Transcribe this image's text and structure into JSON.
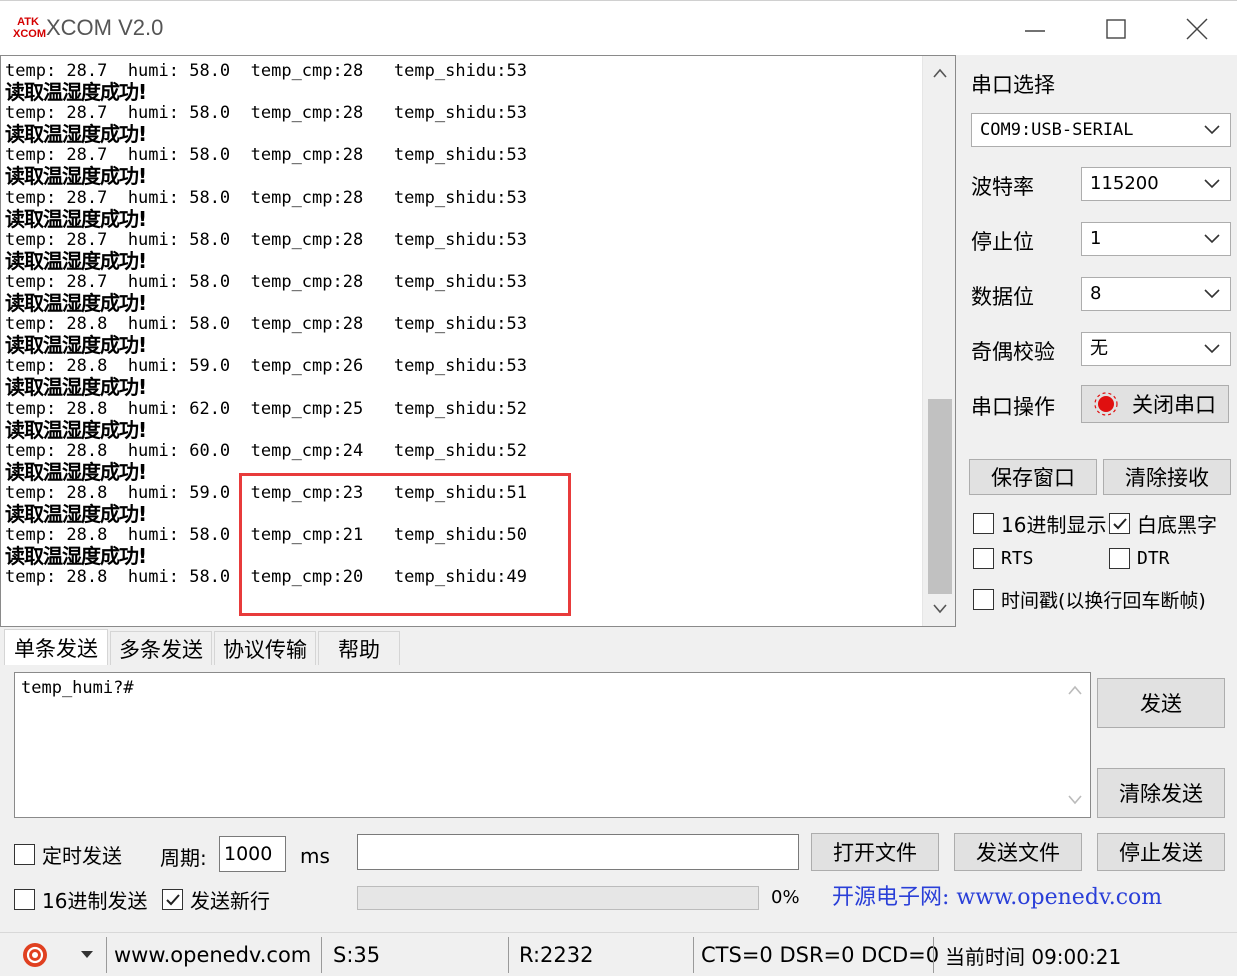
{
  "window": {
    "title": "XCOM V2.0",
    "logo_text_top": "ATK",
    "logo_text_bottom": "XCOM",
    "minimize_icon": "minimize-icon",
    "maximize_icon": "maximize-icon",
    "close_icon": "close-icon"
  },
  "receive": {
    "lines": [
      "temp: 28.7  humi: 58.0  temp_cmp:28   temp_shidu:53",
      "读取温湿度成功!",
      "temp: 28.7  humi: 58.0  temp_cmp:28   temp_shidu:53",
      "读取温湿度成功!",
      "temp: 28.7  humi: 58.0  temp_cmp:28   temp_shidu:53",
      "读取温湿度成功!",
      "temp: 28.7  humi: 58.0  temp_cmp:28   temp_shidu:53",
      "读取温湿度成功!",
      "temp: 28.7  humi: 58.0  temp_cmp:28   temp_shidu:53",
      "读取温湿度成功!",
      "temp: 28.7  humi: 58.0  temp_cmp:28   temp_shidu:53",
      "读取温湿度成功!",
      "temp: 28.8  humi: 58.0  temp_cmp:28   temp_shidu:53",
      "读取温湿度成功!",
      "temp: 28.8  humi: 59.0  temp_cmp:26   temp_shidu:53",
      "读取温湿度成功!",
      "temp: 28.8  humi: 62.0  temp_cmp:25   temp_shidu:52",
      "读取温湿度成功!",
      "temp: 28.8  humi: 60.0  temp_cmp:24   temp_shidu:52",
      "读取温湿度成功!",
      "temp: 28.8  humi: 59.0  temp_cmp:23   temp_shidu:51",
      "读取温湿度成功!",
      "temp: 28.8  humi: 58.0  temp_cmp:21   temp_shidu:50",
      "读取温湿度成功!",
      "temp: 28.8  humi: 58.0  temp_cmp:20   temp_shidu:49"
    ]
  },
  "settings": {
    "port_select_label": "串口选择",
    "port_value": "COM9:USB-SERIAL",
    "baud_label": "波特率",
    "baud_value": "115200",
    "stop_label": "停止位",
    "stop_value": "1",
    "data_label": "数据位",
    "data_value": "8",
    "parity_label": "奇偶校验",
    "parity_value": "无",
    "op_label": "串口操作",
    "op_button": "关闭串口",
    "save_window": "保存窗口",
    "clear_receive": "清除接收",
    "hex_display": "16进制显示",
    "white_black": "白底黑字",
    "rts": "RTS",
    "dtr": "DTR",
    "timestamp": "时间戳(以换行回车断帧)",
    "hex_display_checked": false,
    "white_black_checked": true,
    "rts_checked": false,
    "dtr_checked": false,
    "timestamp_checked": false
  },
  "tabs": [
    "单条发送",
    "多条发送",
    "协议传输",
    "帮助"
  ],
  "send": {
    "text": "temp_humi?#",
    "send_button": "发送",
    "clear_send_button": "清除发送",
    "timed_send": "定时发送",
    "timed_send_checked": false,
    "period_label": "周期:",
    "period_value": "1000",
    "ms_label": "ms",
    "open_file": "打开文件",
    "send_file": "发送文件",
    "stop_send": "停止发送",
    "hex_send": "16进制发送",
    "hex_send_checked": false,
    "new_line": "发送新行",
    "new_line_checked": true,
    "progress_percent": "0%",
    "progress_value": 0,
    "site_banner": "开源电子网: www.openedv.com"
  },
  "status": {
    "website": "www.openedv.com",
    "sent": "S:35",
    "received": "R:2232",
    "signals": "CTS=0 DSR=0 DCD=0",
    "time": "当前时间 09:00:21"
  },
  "colors": {
    "highlight": "#e83b3b",
    "banner_text": "#2a3fd8",
    "status_icon": "#e04020"
  }
}
